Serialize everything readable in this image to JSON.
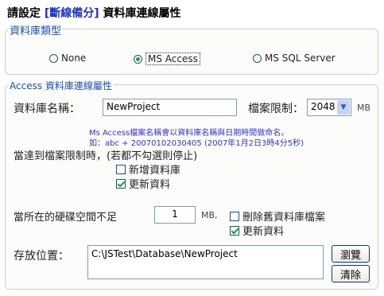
{
  "title": {
    "prefix": "請設定",
    "highlight": "[斷線備分]",
    "suffix": "資料庫連線屬性"
  },
  "db_type": {
    "legend": "資料庫類型",
    "options": [
      {
        "label": "None",
        "selected": false
      },
      {
        "label": "MS Access",
        "selected": true
      },
      {
        "label": "MS SQL Server",
        "selected": false
      }
    ]
  },
  "access": {
    "legend": "Access 資料庫連線屬性",
    "db_name_label": "資料庫名稱：",
    "db_name_value": "NewProject",
    "file_limit_label": "檔案限制：",
    "file_limit_value": "2048",
    "file_limit_unit": "MB",
    "hint_line1": "Ms Access檔案名稱會以資料庫名稱與日期時間做命名。",
    "hint_line2": "如：abc + 20070102030405 (2007年1月2日3時4分5秒)",
    "limit_reached_label": "當達到檔案限制時，(若都不勾選則停止)",
    "new_db_label": "新增資料庫",
    "new_db_checked": false,
    "update_label": "更新資料",
    "update_checked": true,
    "disk_low_label": "當所在的硬碟空間不足",
    "disk_value": "1",
    "disk_unit": "MB,",
    "delete_old_label": "刪除舊資料庫檔案",
    "delete_old_checked": false,
    "update2_label": "更新資料",
    "update2_checked": true,
    "location_label": "存放位置：",
    "location_value": "C:\\JSTest\\Database\\NewProject",
    "browse_label": "瀏覽",
    "clear_label": "清除"
  },
  "colors": {
    "accent": "#2050b0",
    "highlight": "#2233bb",
    "hint": "#3333cc",
    "check": "#21a121"
  }
}
